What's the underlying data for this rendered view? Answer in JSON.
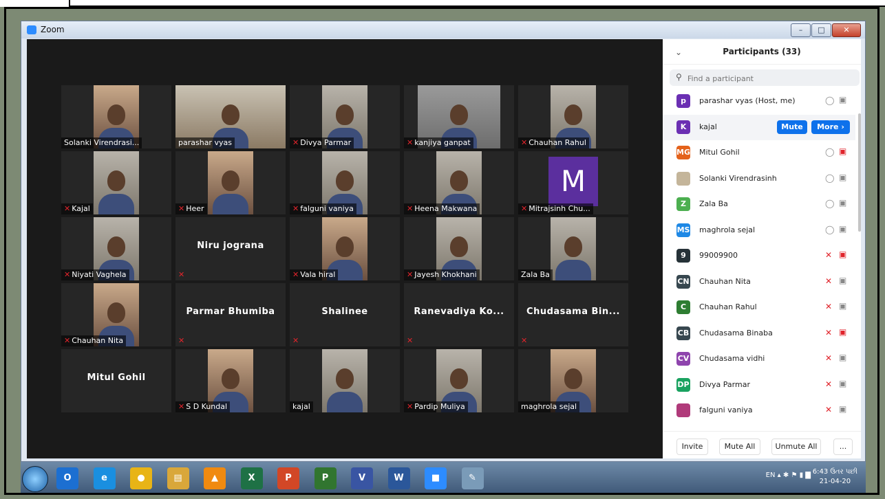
{
  "window": {
    "title": "Zoom"
  },
  "tiles": [
    {
      "label": "Solanki Virendrasi...",
      "muted": false,
      "type": "cam"
    },
    {
      "label": "parashar vyas",
      "muted": false,
      "type": "cam-wide",
      "speaking": true
    },
    {
      "label": "Divya Parmar",
      "muted": true,
      "type": "cam"
    },
    {
      "label": "kanjiya ganpat",
      "muted": true,
      "type": "cam-gray"
    },
    {
      "label": "Chauhan Rahul",
      "muted": true,
      "type": "cam"
    },
    {
      "label": "Kajal",
      "muted": true,
      "type": "cam"
    },
    {
      "label": "Heer",
      "muted": true,
      "type": "cam"
    },
    {
      "label": "falguni vaniya",
      "muted": true,
      "type": "cam"
    },
    {
      "label": "Heena Makwana",
      "muted": true,
      "type": "cam"
    },
    {
      "label": "Mitrajsinh Chu...",
      "muted": true,
      "type": "avatar",
      "initial": "M"
    },
    {
      "label": "Niyati Vaghela",
      "muted": true,
      "type": "cam"
    },
    {
      "label": "Niru jograna",
      "muted": true,
      "type": "name"
    },
    {
      "label": "Vala hiral",
      "muted": true,
      "type": "cam"
    },
    {
      "label": "Jayesh Khokhani",
      "muted": true,
      "type": "cam"
    },
    {
      "label": "Zala Ba",
      "muted": false,
      "type": "cam"
    },
    {
      "label": "Chauhan Nita",
      "muted": true,
      "type": "cam"
    },
    {
      "label": "Parmar Bhumiba",
      "muted": true,
      "type": "name"
    },
    {
      "label": "Shalinee",
      "muted": true,
      "type": "name"
    },
    {
      "label": "Ranevadiya Ko...",
      "muted": true,
      "type": "name"
    },
    {
      "label": "Chudasama Bin...",
      "muted": true,
      "type": "name"
    },
    {
      "label": "Mitul Gohil",
      "muted": false,
      "type": "name"
    },
    {
      "label": "S D Kundal",
      "muted": true,
      "type": "cam"
    },
    {
      "label": "kajal",
      "muted": false,
      "type": "cam"
    },
    {
      "label": "Pardip Muliya",
      "muted": true,
      "type": "cam"
    },
    {
      "label": "maghrola sejal",
      "muted": false,
      "type": "cam"
    }
  ],
  "panel": {
    "title": "Participants (33)",
    "search_placeholder": "Find a participant",
    "mute_label": "Mute",
    "more_label": "More ›",
    "participants": [
      {
        "initials": "p",
        "color": "#6b2fb3",
        "name": "parashar vyas (Host, me)",
        "mic": "on",
        "video": "on"
      },
      {
        "initials": "K",
        "color": "#6b2fb3",
        "name": "kajal",
        "mic": "hover",
        "video": "hover"
      },
      {
        "initials": "MG",
        "color": "#e4621b",
        "name": "Mitul Gohil",
        "mic": "on",
        "video": "off"
      },
      {
        "initials": "",
        "color": "#c4b59a",
        "name": "Solanki Virendrasinh",
        "mic": "on",
        "video": "on"
      },
      {
        "initials": "Z",
        "color": "#4caf50",
        "name": "Zala Ba",
        "mic": "on",
        "video": "on"
      },
      {
        "initials": "MS",
        "color": "#1e88e5",
        "name": "maghrola sejal",
        "mic": "on",
        "video": "on"
      },
      {
        "initials": "9",
        "color": "#263238",
        "name": "99009900",
        "mic": "off",
        "video": "off"
      },
      {
        "initials": "CN",
        "color": "#37474f",
        "name": "Chauhan Nita",
        "mic": "off",
        "video": "on"
      },
      {
        "initials": "C",
        "color": "#2e7d32",
        "name": "Chauhan Rahul",
        "mic": "off",
        "video": "on"
      },
      {
        "initials": "CB",
        "color": "#37474f",
        "name": "Chudasama Binaba",
        "mic": "off",
        "video": "off"
      },
      {
        "initials": "CV",
        "color": "#8e44ad",
        "name": "Chudasama vidhi",
        "mic": "off",
        "video": "on"
      },
      {
        "initials": "DP",
        "color": "#1aa260",
        "name": "Divya Parmar",
        "mic": "off",
        "video": "on"
      },
      {
        "initials": "",
        "color": "#b03a7a",
        "name": "falguni vaniya",
        "mic": "off",
        "video": "on"
      }
    ],
    "footer": {
      "invite": "Invite",
      "mute_all": "Mute All",
      "unmute_all": "Unmute All",
      "more": "..."
    }
  },
  "taskbar": {
    "apps": [
      {
        "name": "outlook-icon",
        "glyph": "O",
        "color": "#1c6fd1"
      },
      {
        "name": "ie-icon",
        "glyph": "e",
        "color": "#1a8fe0"
      },
      {
        "name": "chrome-icon",
        "glyph": "●",
        "color": "#e8b416"
      },
      {
        "name": "explorer-icon",
        "glyph": "▤",
        "color": "#d9a73a"
      },
      {
        "name": "vlc-icon",
        "glyph": "▲",
        "color": "#f08a10"
      },
      {
        "name": "excel-icon",
        "glyph": "X",
        "color": "#1e7145"
      },
      {
        "name": "powerpoint-icon",
        "glyph": "P",
        "color": "#d24726"
      },
      {
        "name": "project-icon",
        "glyph": "P",
        "color": "#31752f"
      },
      {
        "name": "visio-icon",
        "glyph": "V",
        "color": "#3955a3"
      },
      {
        "name": "word-icon",
        "glyph": "W",
        "color": "#2b579a"
      },
      {
        "name": "zoom-icon",
        "glyph": "■",
        "color": "#2d8cff"
      },
      {
        "name": "paint-icon",
        "glyph": "✎",
        "color": "#7a9bb8"
      }
    ],
    "lang": "EN",
    "time": "6:43 ઉતર પછી",
    "date": "21-04-20"
  }
}
